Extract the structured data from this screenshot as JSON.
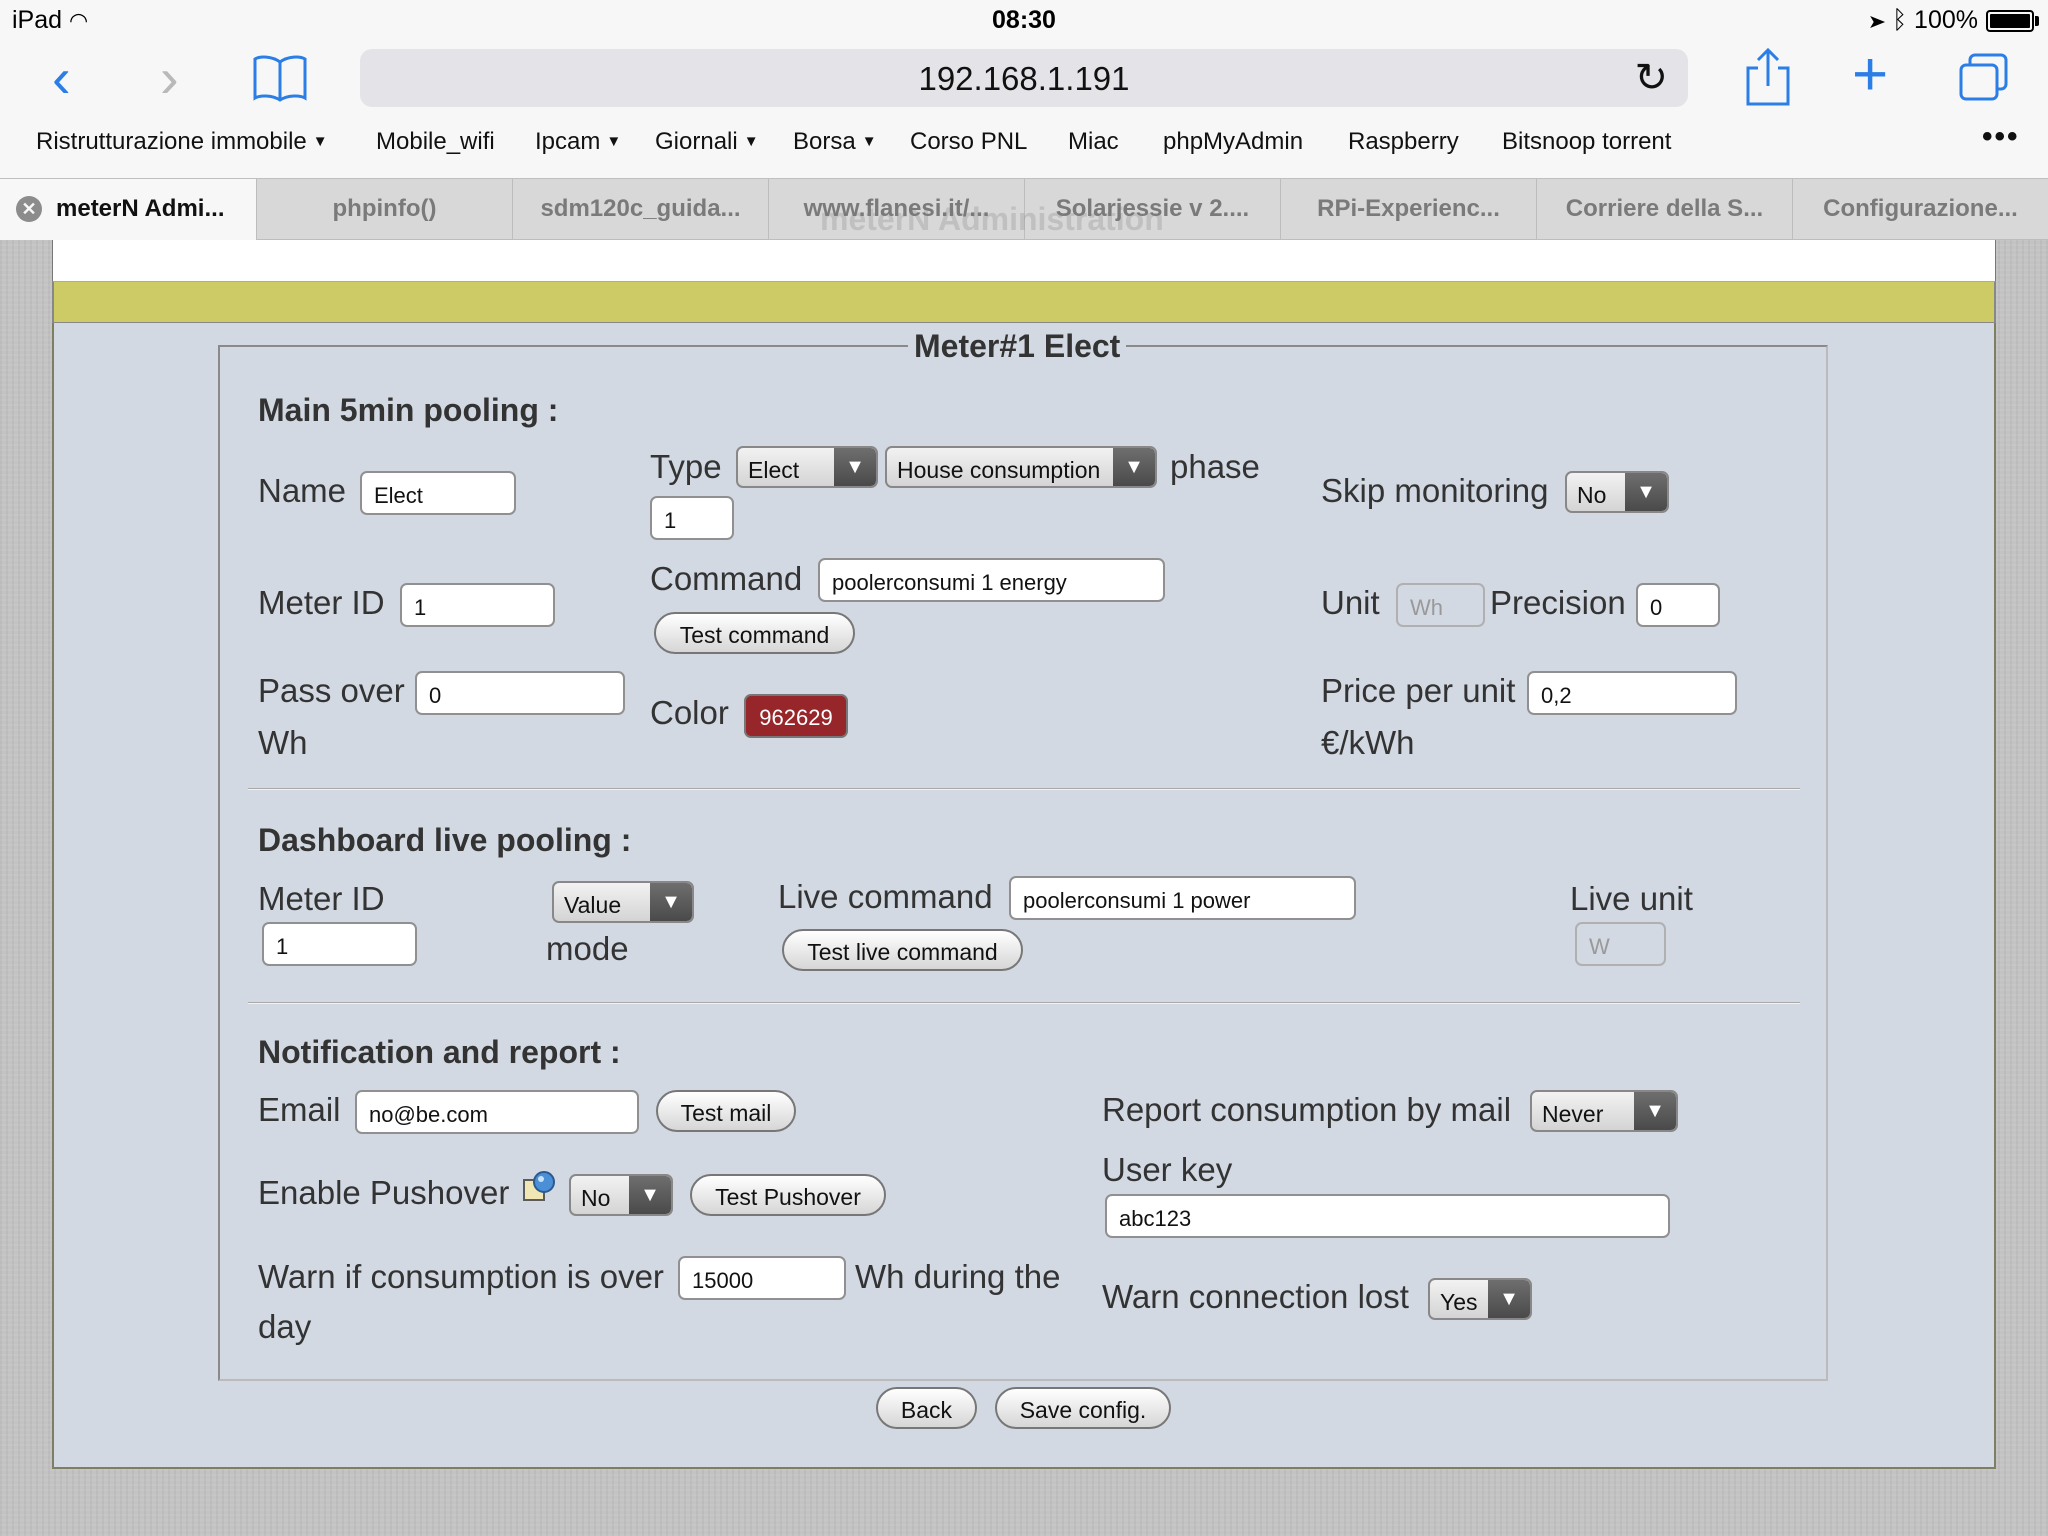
{
  "status": {
    "device": "iPad",
    "time": "08:30",
    "battery": "100%"
  },
  "browser": {
    "url": "192.168.1.191",
    "bookmarks": [
      {
        "label": "Ristrutturazione immobile",
        "folder": true
      },
      {
        "label": "Mobile_wifi",
        "folder": false
      },
      {
        "label": "Ipcam",
        "folder": true
      },
      {
        "label": "Giornali",
        "folder": true
      },
      {
        "label": "Borsa",
        "folder": true
      },
      {
        "label": "Corso PNL",
        "folder": false
      },
      {
        "label": "Miac",
        "folder": false
      },
      {
        "label": "phpMyAdmin",
        "folder": false
      },
      {
        "label": "Raspberry",
        "folder": false
      },
      {
        "label": "Bitsnoop torrent",
        "folder": false
      }
    ],
    "tabs": [
      {
        "label": "meterN Admi...",
        "active": true
      },
      {
        "label": "phpinfo()"
      },
      {
        "label": "sdm120c_guida..."
      },
      {
        "label": "www.flanesi.it/..."
      },
      {
        "label": "Solarjessie v 2...."
      },
      {
        "label": "RPi-Experienc..."
      },
      {
        "label": "Corriere della S..."
      },
      {
        "label": "Configurazione..."
      }
    ],
    "ghost_title": "meterN Administration"
  },
  "form": {
    "legend": "Meter#1 Elect",
    "main": {
      "heading": "Main 5min pooling :",
      "name_label": "Name",
      "name_value": "Elect",
      "type_label": "Type",
      "type_value": "Elect",
      "type_sub_value": "House consumption",
      "phase_label": "phase",
      "phase_value": "1",
      "skip_label": "Skip monitoring",
      "skip_value": "No",
      "meterid_label": "Meter ID",
      "meterid_value": "1",
      "command_label": "Command",
      "command_value": "poolerconsumi 1 energy",
      "test_command": "Test command",
      "unit_label": "Unit",
      "unit_placeholder": "Wh",
      "precision_label": "Precision",
      "precision_value": "0",
      "passover_label": "Pass over",
      "passover_value": "0",
      "passover_unit": "Wh",
      "color_label": "Color",
      "color_value": "962629",
      "price_label": "Price per unit",
      "price_value": "0,2",
      "price_unit": "€/kWh"
    },
    "live": {
      "heading": "Dashboard live pooling :",
      "meterid_label": "Meter ID",
      "meterid_value": "1",
      "mode_value": "Value",
      "mode_label": "mode",
      "command_label": "Live command",
      "command_value": "poolerconsumi 1 power",
      "test_button": "Test live command",
      "unit_label": "Live unit",
      "unit_placeholder": "W"
    },
    "notify": {
      "heading": "Notification and report :",
      "email_label": "Email",
      "email_value": "no@be.com",
      "test_mail": "Test mail",
      "report_label": "Report consumption by mail",
      "report_value": "Never",
      "pushover_label": "Enable Pushover",
      "pushover_value": "No",
      "test_pushover": "Test Pushover",
      "userkey_label": "User key",
      "userkey_value": "abc123",
      "warn_label": "Warn if consumption is over",
      "warn_value": "15000",
      "warn_suffix": "Wh during the",
      "warn_suffix2": "day",
      "lost_label": "Warn connection lost",
      "lost_value": "Yes"
    },
    "buttons": {
      "back": "Back",
      "save": "Save config."
    }
  }
}
